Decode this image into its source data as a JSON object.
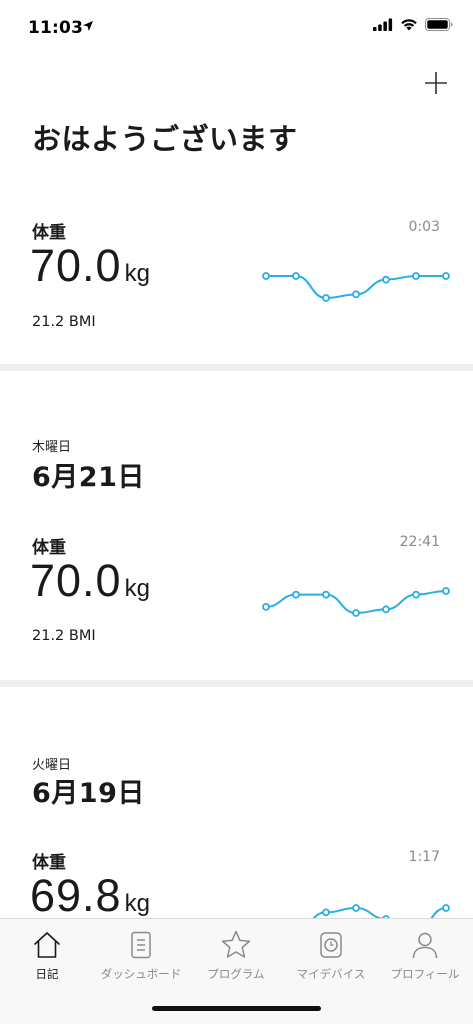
{
  "status_bar": {
    "time": "11:03"
  },
  "greeting": "おはようございます",
  "accent_color": "#29aee6",
  "cards": [
    {
      "label": "体重",
      "time": "0:03",
      "value": "70.0",
      "unit": "kg",
      "bmi": "21.2 BMI",
      "trend": [
        70.1,
        70.1,
        69.8,
        69.85,
        70.05,
        70.1,
        70.1
      ]
    },
    {
      "label": "体重",
      "time": "22:41",
      "value": "70.0",
      "unit": "kg",
      "bmi": "21.2 BMI",
      "trend": [
        69.85,
        69.95,
        69.95,
        69.8,
        69.83,
        69.95,
        69.98
      ]
    },
    {
      "label": "体重",
      "time": "1:17",
      "value": "69.8",
      "unit": "kg",
      "bmi": "",
      "trend": [
        69.7,
        69.7,
        69.78,
        69.8,
        69.75,
        69.7,
        69.8
      ]
    }
  ],
  "days": [
    {
      "weekday": "木曜日",
      "date": "6月21日"
    },
    {
      "weekday": "火曜日",
      "date": "6月19日"
    }
  ],
  "tabs": [
    {
      "label": "日記",
      "icon": "home-icon",
      "active": true
    },
    {
      "label": "ダッシュボード",
      "icon": "dashboard-icon",
      "active": false
    },
    {
      "label": "プログラム",
      "icon": "star-icon",
      "active": false
    },
    {
      "label": "マイデバイス",
      "icon": "watch-icon",
      "active": false
    },
    {
      "label": "プロフィール",
      "icon": "person-icon",
      "active": false
    }
  ]
}
